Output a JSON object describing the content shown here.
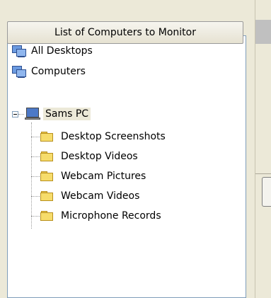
{
  "panel": {
    "header_label": "List of Computers to Monitor"
  },
  "tree": {
    "all_desktops": "All Desktops",
    "computers": "Computers",
    "computer": "Sams PC",
    "folders": [
      "Desktop Screenshots",
      "Desktop Videos",
      "Webcam Pictures",
      "Webcam Videos",
      "Microphone Records"
    ]
  },
  "colors": {
    "window_background": "#ece9d8",
    "tree_border": "#7f9db9",
    "folder_fill": "#f6dc6b"
  },
  "icons": {
    "all_desktops": "computers-icon",
    "computers": "computers-icon",
    "computer": "monitor-icon",
    "folder": "folder-icon",
    "expander": "collapse-minus-icon"
  }
}
